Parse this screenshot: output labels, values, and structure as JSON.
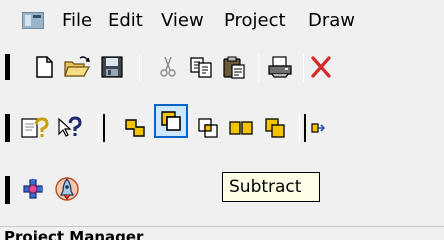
{
  "menubar": {
    "items": [
      "File",
      "Edit",
      "View",
      "Project",
      "Draw"
    ]
  },
  "toolbar_standard": {
    "buttons": [
      "new-document-icon",
      "open-folder-icon",
      "save-icon",
      "cut-icon",
      "copy-icon",
      "paste-icon",
      "print-icon",
      "delete-icon"
    ]
  },
  "toolbar_boolean": {
    "buttons": [
      "help-topics-icon",
      "whats-this-help-icon",
      "unite-icon",
      "subtract-icon",
      "intersect-icon",
      "split-icon",
      "imprint-icon",
      "toolbar-overflow-icon"
    ],
    "pressed": "subtract-icon"
  },
  "toolbar_model": {
    "buttons": [
      "puzzle-pieces-icon",
      "rocket-icon"
    ]
  },
  "tooltip": {
    "text": "Subtract"
  },
  "panel": {
    "title": "Project Manager"
  },
  "colors": {
    "pressed_fill": "#cce8ff",
    "pressed_border": "#0a64c8",
    "tooltip_bg": "#ffffe8",
    "delete_red": "#d42a2a",
    "boolean_yellow": "#f2c400"
  }
}
